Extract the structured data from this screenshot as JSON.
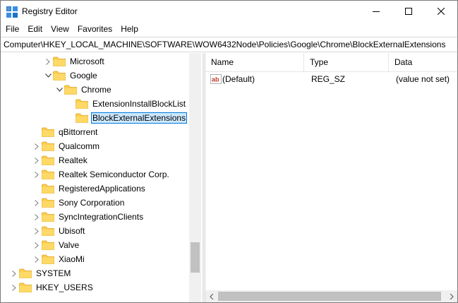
{
  "window": {
    "title": "Registry Editor",
    "icon": "registry-editor-icon"
  },
  "menu": {
    "items": [
      "File",
      "Edit",
      "View",
      "Favorites",
      "Help"
    ]
  },
  "address": {
    "path": "Computer\\HKEY_LOCAL_MACHINE\\SOFTWARE\\WOW6432Node\\Policies\\Google\\Chrome\\BlockExternalExtensions"
  },
  "tree": {
    "items": [
      {
        "label": "Microsoft",
        "expander": "collapsed"
      },
      {
        "label": "Google",
        "expander": "expanded"
      },
      {
        "label": "Chrome",
        "expander": "expanded"
      },
      {
        "label": "ExtensionInstallBlockList",
        "expander": "none"
      },
      {
        "label": "BlockExternalExtensions",
        "expander": "none",
        "selected": true
      },
      {
        "label": "qBittorrent",
        "expander": "none"
      },
      {
        "label": "Qualcomm",
        "expander": "collapsed"
      },
      {
        "label": "Realtek",
        "expander": "collapsed"
      },
      {
        "label": "Realtek Semiconductor Corp.",
        "expander": "collapsed"
      },
      {
        "label": "RegisteredApplications",
        "expander": "none"
      },
      {
        "label": "Sony Corporation",
        "expander": "collapsed"
      },
      {
        "label": "SyncIntegrationClients",
        "expander": "collapsed"
      },
      {
        "label": "Ubisoft",
        "expander": "collapsed"
      },
      {
        "label": "Valve",
        "expander": "collapsed"
      },
      {
        "label": "XiaoMi",
        "expander": "collapsed"
      },
      {
        "label": "SYSTEM",
        "expander": "collapsed"
      },
      {
        "label": "HKEY_USERS",
        "expander": "collapsed"
      }
    ]
  },
  "list": {
    "columns": [
      "Name",
      "Type",
      "Data"
    ],
    "rows": [
      {
        "icon": "string-value-icon",
        "name": "(Default)",
        "type": "REG_SZ",
        "data": "(value not set)"
      }
    ]
  },
  "colors": {
    "selection_bg": "#cce8ff",
    "selection_border": "#0078d7",
    "folder": "#ffcc4d"
  }
}
